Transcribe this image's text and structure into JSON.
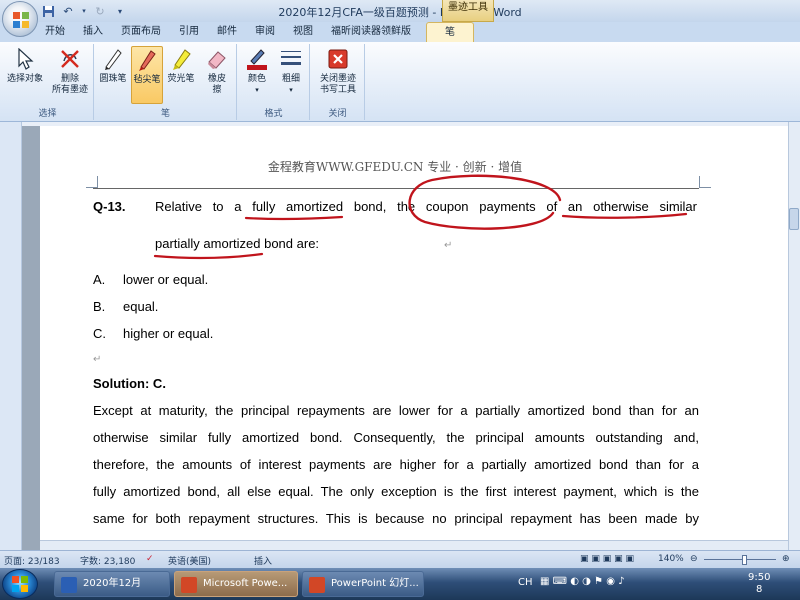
{
  "window": {
    "title": "2020年12月CFA一级百题预测 - Microsoft Word",
    "context_tab": "墨迹工具"
  },
  "tabs": [
    "开始",
    "插入",
    "页面布局",
    "引用",
    "邮件",
    "审阅",
    "视图",
    "福昕阅读器领鲜版",
    "笔"
  ],
  "active_tab": "笔",
  "ribbon": {
    "select_group": {
      "label": "选择",
      "select_objects": "选择对象",
      "delete_ink_1": "删除",
      "delete_ink_2": "所有墨迹"
    },
    "pen_group": {
      "label": "笔",
      "ballpoint": "圆珠笔",
      "felt_tip": "毡尖笔",
      "highlighter": "荧光笔",
      "eraser_1": "橡皮",
      "eraser_2": "擦"
    },
    "format_group": {
      "label": "格式",
      "color": "颜色",
      "thickness": "粗细"
    },
    "close_group": {
      "label": "关闭",
      "close_1": "关闭墨迹",
      "close_2": "书写工具"
    }
  },
  "document": {
    "header": "金程教育WWW.GFEDU.CN 专业 · 创新 · 增值",
    "question_number": "Q-13.",
    "question_line1": "Relative to a fully amortized bond, the coupon payments of an otherwise similar",
    "question_line2": "partially amortized bond are:",
    "options": [
      {
        "letter": "A.",
        "text": "lower or equal."
      },
      {
        "letter": "B.",
        "text": "equal."
      },
      {
        "letter": "C.",
        "text": "higher or equal."
      }
    ],
    "solution_heading": "Solution: C.",
    "solution_lines": [
      "Except at maturity, the principal repayments are lower for a partially amortized bond than for an",
      "otherwise similar fully amortized bond. Consequently, the principal amounts outstanding and,",
      "therefore, the amounts of interest payments are higher for a partially amortized bond than for a",
      "fully amortized bond, all else equal. The only exception is the first interest payment, which is the",
      "same for both repayment structures. This is because no principal repayment has been made by"
    ],
    "ink_color": "#c0141c"
  },
  "status": {
    "page": "页面: 23/183",
    "words": "字数: 23,180",
    "language": "英语(美国)",
    "mode": "插入",
    "zoom": "140%"
  },
  "taskbar": {
    "tasks": [
      "2020年12月CFA...",
      "Microsoft Powe...",
      "PowerPoint 幻灯..."
    ],
    "tray_lang": "CH",
    "time": "9:50",
    "date": "8"
  }
}
